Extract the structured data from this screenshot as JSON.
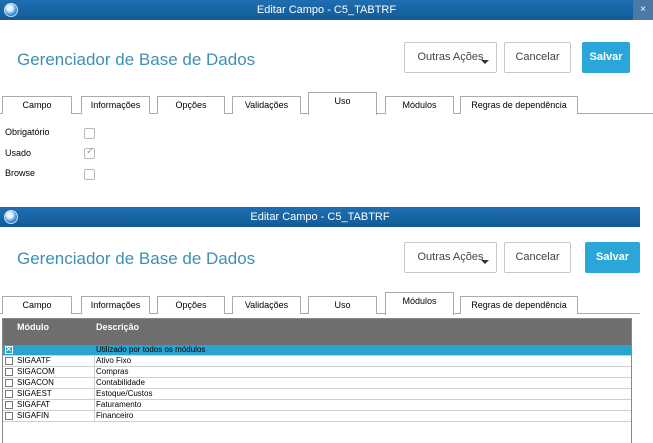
{
  "window1": {
    "title": "Editar Campo - C5_TABTRF",
    "close": "×",
    "app_title": "Gerenciador de Base de Dados",
    "buttons": {
      "outras": "Outras Ações",
      "cancelar": "Cancelar",
      "salvar": "Salvar"
    },
    "tabs": [
      "Campo",
      "Informações",
      "Opções",
      "Validações",
      "Uso",
      "Módulos",
      "Regras de dependência"
    ],
    "active_tab": "Uso",
    "uso_fields": [
      {
        "label": "Obrigatório",
        "checked": false
      },
      {
        "label": "Usado",
        "checked": true
      },
      {
        "label": "Browse",
        "checked": false
      }
    ]
  },
  "window2": {
    "title": "Editar Campo - C5_TABTRF",
    "app_title": "Gerenciador de Base de Dados",
    "buttons": {
      "outras": "Outras Ações",
      "cancelar": "Cancelar",
      "salvar": "Salvar"
    },
    "tabs": [
      "Campo",
      "Informações",
      "Opções",
      "Validações",
      "Uso",
      "Módulos",
      "Regras de dependência"
    ],
    "active_tab": "Módulos",
    "grid": {
      "columns": [
        "Módulo",
        "Descrição"
      ],
      "rows": [
        {
          "modulo": "",
          "descricao": "Utilizado por todos os módulos",
          "checked": true
        },
        {
          "modulo": "SIGAATF",
          "descricao": "Ativo Fixo",
          "checked": false
        },
        {
          "modulo": "SIGACOM",
          "descricao": "Compras",
          "checked": false
        },
        {
          "modulo": "SIGACON",
          "descricao": "Contabilidade",
          "checked": false
        },
        {
          "modulo": "SIGAEST",
          "descricao": "Estoque/Custos",
          "checked": false
        },
        {
          "modulo": "SIGAFAT",
          "descricao": "Faturamento",
          "checked": false
        },
        {
          "modulo": "SIGAFIN",
          "descricao": "Financeiro",
          "checked": false
        }
      ]
    }
  },
  "colors": {
    "titlebar": "#1566a6",
    "accent": "#2aa7d8",
    "app_title": "#3e8fb3",
    "grid_header": "#6e6e6e"
  }
}
